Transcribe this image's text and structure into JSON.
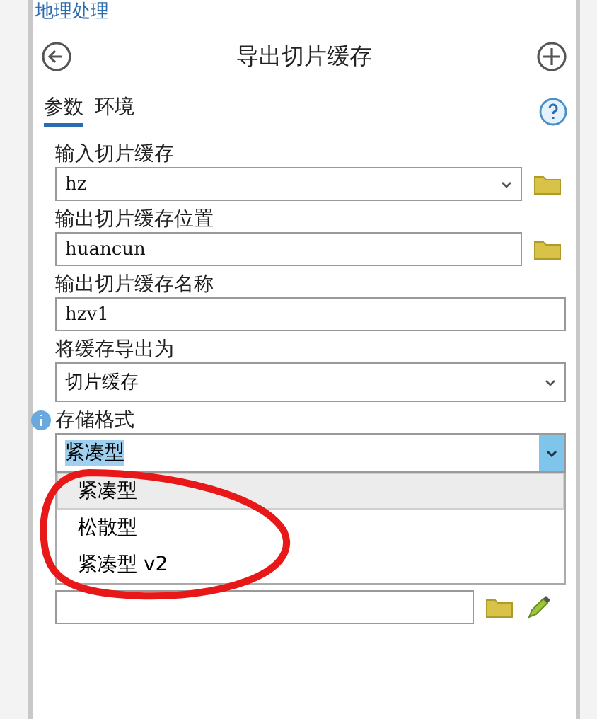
{
  "pane": {
    "title": "地理处理"
  },
  "header": {
    "title": "导出切片缓存"
  },
  "tabs": [
    {
      "label": "参数",
      "selected": true
    },
    {
      "label": "环境",
      "selected": false
    }
  ],
  "params": [
    {
      "kind": "combo",
      "label": "输入切片缓存",
      "value": "hz",
      "browse": true
    },
    {
      "kind": "text",
      "label": "输出切片缓存位置",
      "value": "huancun",
      "browse": true
    },
    {
      "kind": "text",
      "label": "输出切片缓存名称",
      "value": "hzv1",
      "browse": false
    },
    {
      "kind": "select",
      "label": "将缓存导出为",
      "value": "切片缓存",
      "browse": false
    }
  ],
  "storage": {
    "label": "存储格式",
    "value": "紧凑型",
    "open": true,
    "options": [
      {
        "label": "紧凑型",
        "selected": true
      },
      {
        "label": "松散型",
        "selected": false
      },
      {
        "label": "紧凑型 v2",
        "selected": false
      }
    ]
  },
  "last_field": {
    "browse": true,
    "edit": true
  }
}
